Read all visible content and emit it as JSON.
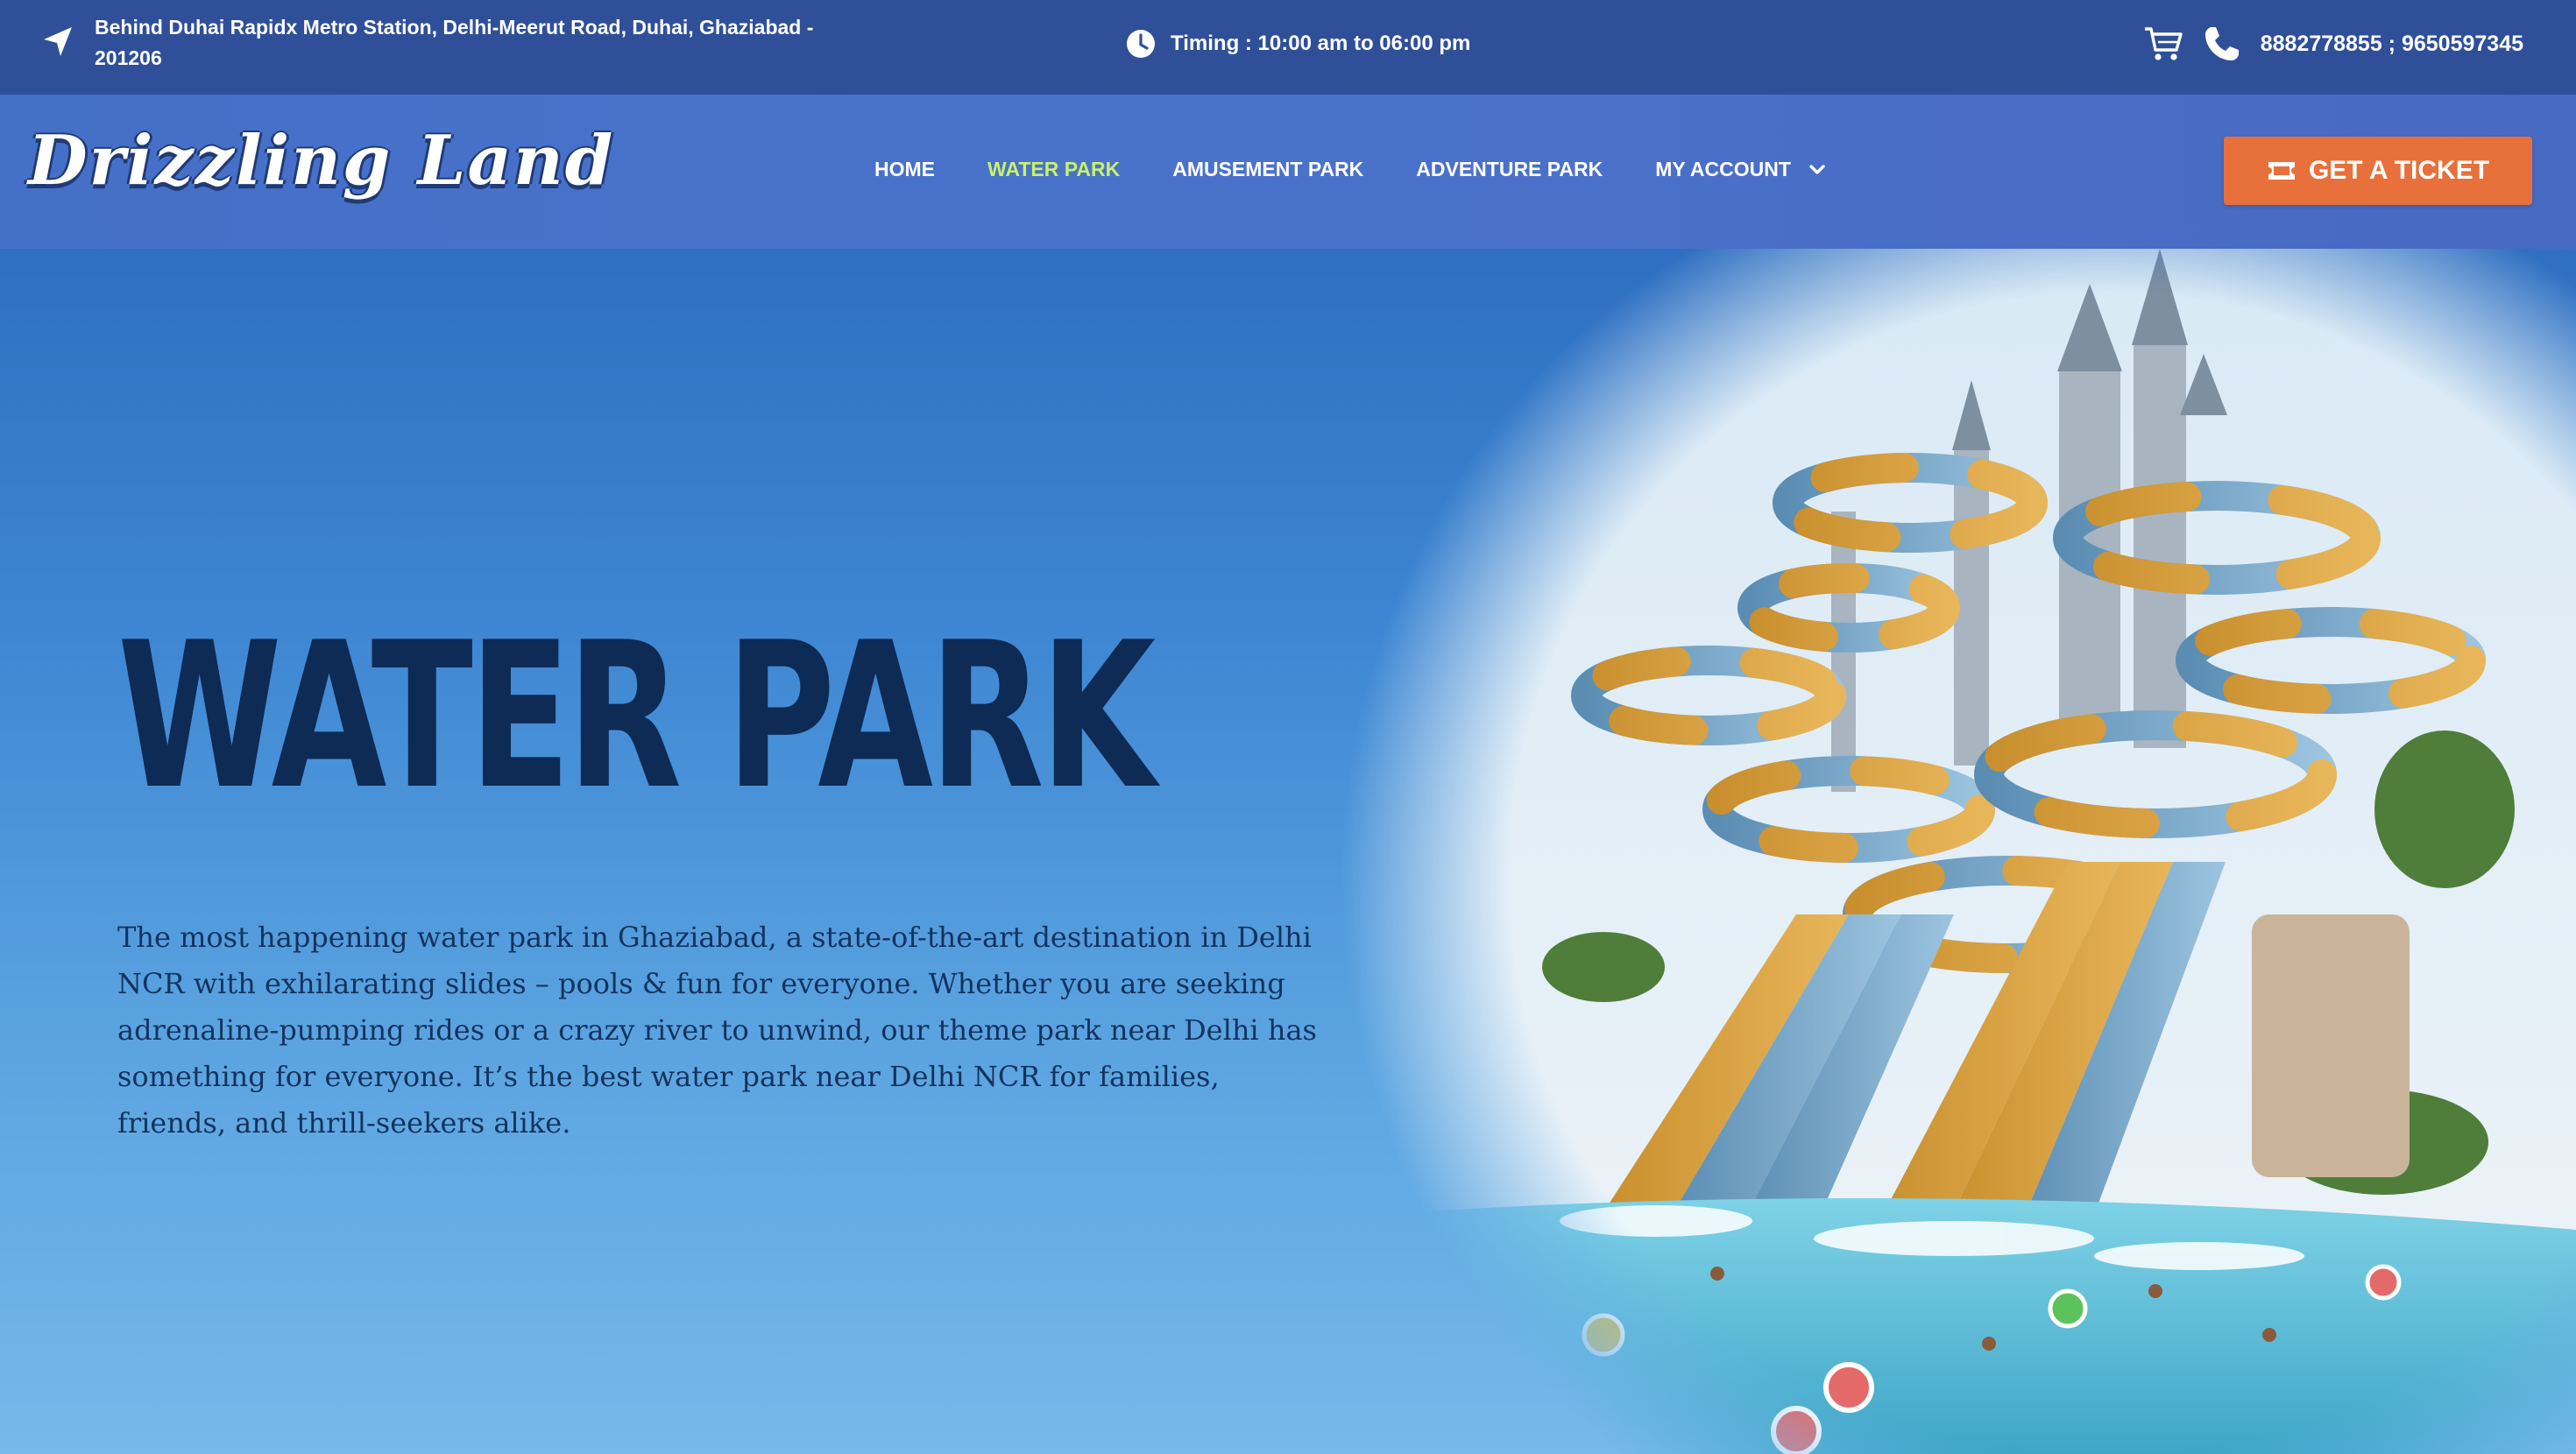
{
  "topbar": {
    "address": "Behind Duhai Rapidx Metro Station, Delhi-Meerut Road, Duhai, Ghaziabad - 201206",
    "timing": "Timing : 10:00 am to 06:00 pm",
    "phones": "8882778855 ; 9650597345",
    "icons": [
      "location-arrow-icon",
      "clock-icon",
      "cart-icon",
      "phone-icon"
    ]
  },
  "header": {
    "logo": "Drizzling Land",
    "nav": {
      "home": "HOME",
      "water_park": "WATER PARK",
      "amusement_park": "AMUSEMENT PARK",
      "adventure_park": "ADVENTURE PARK",
      "my_account": "MY ACCOUNT"
    },
    "active_item": "WATER PARK",
    "cta": "GET A TICKET"
  },
  "hero": {
    "title": "WATER PARK",
    "description": "The most happening water park in Ghaziabad, a state-of-the-art destination in Delhi NCR with exhilarating slides – pools & fun for everyone. Whether you are seeking adrenaline-pumping rides or a crazy river to unwind, our theme park near Delhi has something for everyone. It’s the best water park near Delhi NCR for families, friends, and thrill-seekers alike."
  },
  "colors": {
    "topbar_bg": "#2f4f98",
    "navbar_bg": "#4a72cb",
    "nav_active": "#c7f26a",
    "cta_bg": "#e8703b",
    "hero_title": "#0d2b55",
    "hero_text": "#14335e"
  }
}
